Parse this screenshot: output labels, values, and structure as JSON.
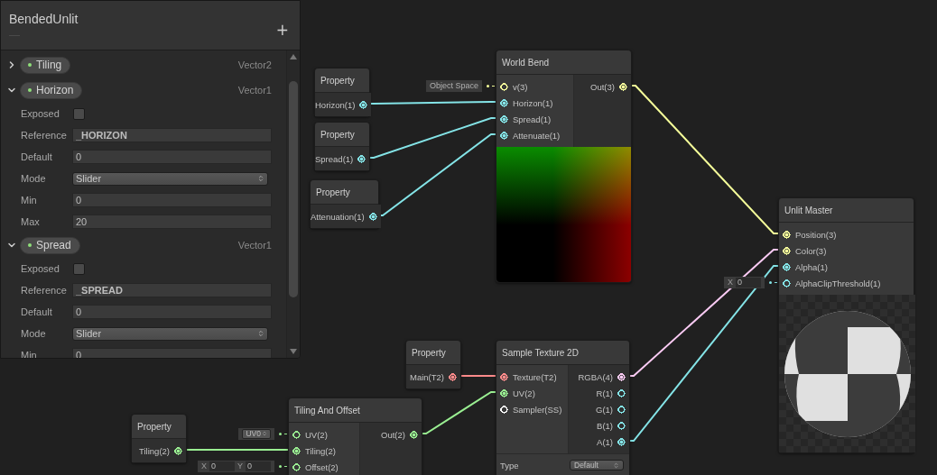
{
  "blackboard": {
    "title": "BendedUnlit",
    "add_button": "+",
    "properties": [
      {
        "name": "Tiling",
        "type": "Vector2",
        "expanded": false
      },
      {
        "name": "Horizon",
        "type": "Vector1",
        "expanded": true,
        "fields": [
          {
            "kind": "checkbox",
            "label": "Exposed",
            "checked": false
          },
          {
            "kind": "reference",
            "label": "Reference",
            "value": "_HORIZON"
          },
          {
            "kind": "text",
            "label": "Default",
            "value": "0"
          },
          {
            "kind": "dropdown",
            "label": "Mode",
            "value": "Slider"
          },
          {
            "kind": "text",
            "label": "Min",
            "value": "0"
          },
          {
            "kind": "text",
            "label": "Max",
            "value": "20"
          }
        ]
      },
      {
        "name": "Spread",
        "type": "Vector1",
        "expanded": true,
        "fields": [
          {
            "kind": "checkbox",
            "label": "Exposed",
            "checked": false
          },
          {
            "kind": "reference",
            "label": "Reference",
            "value": "_SPREAD"
          },
          {
            "kind": "text",
            "label": "Default",
            "value": "0"
          },
          {
            "kind": "dropdown",
            "label": "Mode",
            "value": "Slider"
          },
          {
            "kind": "text",
            "label": "Min",
            "value": "0"
          }
        ]
      }
    ]
  },
  "nodes": [
    {
      "title": "Property",
      "outputs": [
        {
          "label": "Horizon(1)",
          "color": "#84e4e7",
          "connected": true
        }
      ]
    },
    {
      "title": "Property",
      "outputs": [
        {
          "label": "Spread(1)",
          "color": "#84e4e7",
          "connected": true
        }
      ]
    },
    {
      "title": "Property",
      "outputs": [
        {
          "label": "Attenuation(1)",
          "color": "#84e4e7",
          "connected": true
        }
      ]
    },
    {
      "title": "World Bend",
      "preview": {
        "kind": "gradient"
      },
      "inputs": [
        {
          "label": "v(3)",
          "color": "#f6ff9a",
          "connected": false,
          "inline": {
            "kind": "dropdown",
            "value": "Object Space"
          }
        },
        {
          "label": "Horizon(1)",
          "color": "#84e4e7",
          "connected": true
        },
        {
          "label": "Spread(1)",
          "color": "#84e4e7",
          "connected": true
        },
        {
          "label": "Attenuate(1)",
          "color": "#84e4e7",
          "connected": true
        }
      ],
      "outputs": [
        {
          "label": "Out(3)",
          "color": "#f6ff9a",
          "connected": true
        }
      ]
    },
    {
      "title": "Unlit Master",
      "preview": {
        "kind": "sphere"
      },
      "inputs": [
        {
          "label": "Position(3)",
          "color": "#f6ff9a",
          "connected": true
        },
        {
          "label": "Color(3)",
          "color": "#f6ff9a",
          "connected": true
        },
        {
          "label": "Alpha(1)",
          "color": "#84e4e7",
          "connected": true
        },
        {
          "label": "AlphaClipThreshold(1)",
          "color": "#84e4e7",
          "connected": false,
          "inline": {
            "kind": "vector",
            "fields": [
              {
                "axis": "X",
                "value": "0"
              }
            ]
          }
        }
      ]
    },
    {
      "title": "Property",
      "outputs": [
        {
          "label": "Main(T2)",
          "color": "#ff8b8b",
          "connected": true
        }
      ]
    },
    {
      "title": "Sample Texture 2D",
      "inputs": [
        {
          "label": "Texture(T2)",
          "color": "#ff8b8b",
          "connected": true
        },
        {
          "label": "UV(2)",
          "color": "#9aef92",
          "connected": true
        },
        {
          "label": "Sampler(SS)",
          "color": "#ffffff",
          "connected": false
        }
      ],
      "outputs": [
        {
          "label": "RGBA(4)",
          "color": "#fbcbf4",
          "connected": true
        },
        {
          "label": "R(1)",
          "color": "#84e4e7",
          "connected": false
        },
        {
          "label": "G(1)",
          "color": "#84e4e7",
          "connected": false
        },
        {
          "label": "B(1)",
          "color": "#84e4e7",
          "connected": false
        },
        {
          "label": "A(1)",
          "color": "#84e4e7",
          "connected": true
        }
      ],
      "settings": [
        {
          "label": "Type",
          "value": "Default"
        }
      ]
    },
    {
      "title": "Property",
      "outputs": [
        {
          "label": "Tiling(2)",
          "color": "#9aef92",
          "connected": true
        }
      ]
    },
    {
      "title": "Tiling And Offset",
      "inputs": [
        {
          "label": "UV(2)",
          "color": "#9aef92",
          "connected": false,
          "inline": {
            "kind": "channel",
            "value": "UV0"
          }
        },
        {
          "label": "Tiling(2)",
          "color": "#9aef92",
          "connected": true
        },
        {
          "label": "Offset(2)",
          "color": "#9aef92",
          "connected": false,
          "inline": {
            "kind": "vector",
            "fields": [
              {
                "axis": "X",
                "value": "0"
              },
              {
                "axis": "Y",
                "value": "0"
              }
            ]
          }
        }
      ],
      "outputs": [
        {
          "label": "Out(2)",
          "color": "#9aef92",
          "connected": true
        }
      ]
    }
  ]
}
